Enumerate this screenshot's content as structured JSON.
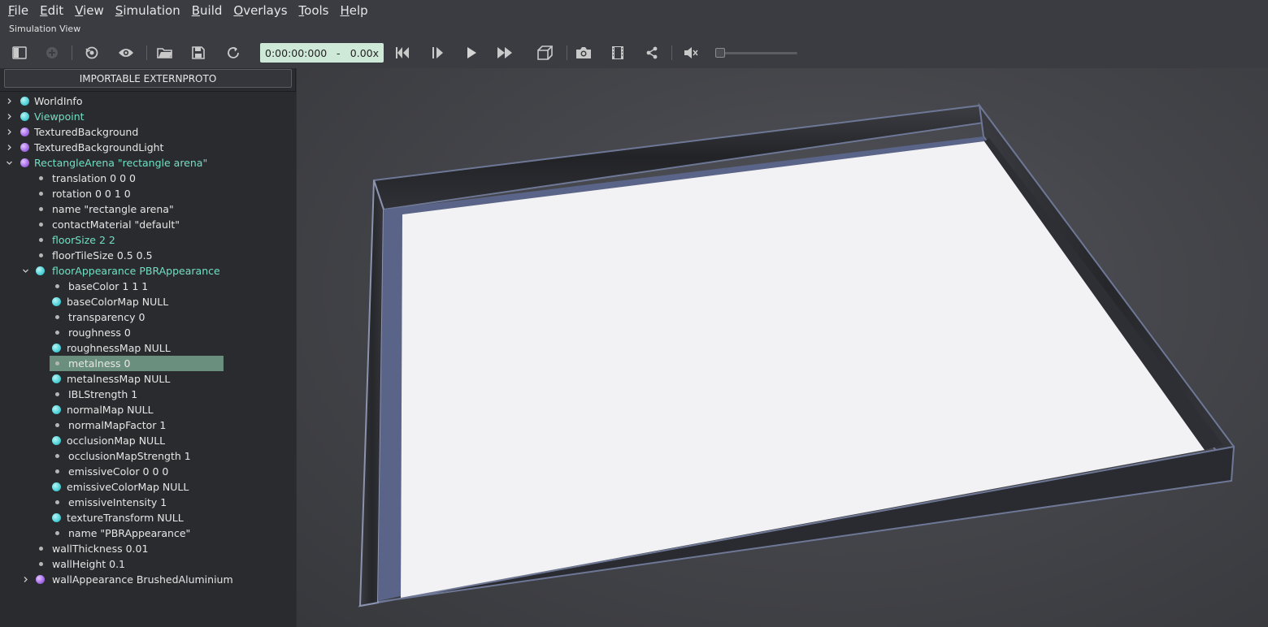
{
  "menu": [
    {
      "key": "F",
      "rest": "ile"
    },
    {
      "key": "E",
      "rest": "dit"
    },
    {
      "key": "V",
      "rest": "iew"
    },
    {
      "key": "S",
      "rest": "imulation"
    },
    {
      "key": "B",
      "rest": "uild"
    },
    {
      "key": "O",
      "rest": "verlays"
    },
    {
      "key": "T",
      "rest": "ools"
    },
    {
      "key": "H",
      "rest": "elp"
    }
  ],
  "view_label": "Simulation View",
  "toolbar": {
    "time": "0:00:00:000",
    "separator": "-",
    "speed": "0.00x",
    "icons": [
      "scene-tree-toggle-icon",
      "add-node-icon",
      "reset-view-icon",
      "eye-icon",
      "open-folder-icon",
      "save-icon",
      "reload-icon",
      "skip-back-icon",
      "step-icon",
      "play-icon",
      "fast-forward-icon",
      "perspective-cube-icon",
      "camera-icon",
      "movie-icon",
      "share-icon",
      "mute-icon"
    ],
    "volume": 0.0
  },
  "left_panel": {
    "proto_button": "IMPORTABLE EXTERNPROTO",
    "tree": [
      {
        "label": "WorldInfo",
        "chev": ">",
        "dot": "cyan",
        "level": 0,
        "hl": false
      },
      {
        "label": "Viewpoint",
        "chev": ">",
        "dot": "cyan",
        "level": 0,
        "hl": true
      },
      {
        "label": "TexturedBackground",
        "chev": ">",
        "dot": "purple",
        "level": 0,
        "hl": false
      },
      {
        "label": "TexturedBackgroundLight",
        "chev": ">",
        "dot": "purple",
        "level": 0,
        "hl": false
      },
      {
        "label": "RectangleArena \"rectangle arena\"",
        "chev": "v",
        "dot": "purple",
        "level": 0,
        "hl": true
      },
      {
        "label": "translation 0 0 0",
        "chev": "",
        "dot": "field",
        "level": 1,
        "hl": false
      },
      {
        "label": "rotation 0 0 1 0",
        "chev": "",
        "dot": "field",
        "level": 1,
        "hl": false
      },
      {
        "label": "name \"rectangle arena\"",
        "chev": "",
        "dot": "field",
        "level": 1,
        "hl": false
      },
      {
        "label": "contactMaterial \"default\"",
        "chev": "",
        "dot": "field",
        "level": 1,
        "hl": false
      },
      {
        "label": "floorSize 2 2",
        "chev": "",
        "dot": "field",
        "level": 1,
        "hl": true
      },
      {
        "label": "floorTileSize 0.5 0.5",
        "chev": "",
        "dot": "field",
        "level": 1,
        "hl": false
      },
      {
        "label": "floorAppearance PBRAppearance",
        "chev": "v",
        "dot": "cyan",
        "level": 1,
        "hl": true
      },
      {
        "label": "baseColor 1 1 1",
        "chev": "",
        "dot": "field",
        "level": 2,
        "hl": false
      },
      {
        "label": "baseColorMap NULL",
        "chev": "",
        "dot": "cyan",
        "level": 2,
        "hl": false
      },
      {
        "label": "transparency 0",
        "chev": "",
        "dot": "field",
        "level": 2,
        "hl": false
      },
      {
        "label": "roughness 0",
        "chev": "",
        "dot": "field",
        "level": 2,
        "hl": false
      },
      {
        "label": "roughnessMap NULL",
        "chev": "",
        "dot": "cyan",
        "level": 2,
        "hl": false
      },
      {
        "label": "metalness 0",
        "chev": "",
        "dot": "field",
        "level": 2,
        "hl": false,
        "selected": true
      },
      {
        "label": "metalnessMap NULL",
        "chev": "",
        "dot": "cyan",
        "level": 2,
        "hl": false
      },
      {
        "label": "IBLStrength 1",
        "chev": "",
        "dot": "field",
        "level": 2,
        "hl": false
      },
      {
        "label": "normalMap NULL",
        "chev": "",
        "dot": "cyan",
        "level": 2,
        "hl": false
      },
      {
        "label": "normalMapFactor 1",
        "chev": "",
        "dot": "field",
        "level": 2,
        "hl": false
      },
      {
        "label": "occlusionMap NULL",
        "chev": "",
        "dot": "cyan",
        "level": 2,
        "hl": false
      },
      {
        "label": "occlusionMapStrength 1",
        "chev": "",
        "dot": "field",
        "level": 2,
        "hl": false
      },
      {
        "label": "emissiveColor 0 0 0",
        "chev": "",
        "dot": "field",
        "level": 2,
        "hl": false
      },
      {
        "label": "emissiveColorMap NULL",
        "chev": "",
        "dot": "cyan",
        "level": 2,
        "hl": false
      },
      {
        "label": "emissiveIntensity 1",
        "chev": "",
        "dot": "field",
        "level": 2,
        "hl": false
      },
      {
        "label": "textureTransform NULL",
        "chev": "",
        "dot": "cyan",
        "level": 2,
        "hl": false
      },
      {
        "label": "name \"PBRAppearance\"",
        "chev": "",
        "dot": "field",
        "level": 2,
        "hl": false
      },
      {
        "label": "wallThickness 0.01",
        "chev": "",
        "dot": "field",
        "level": 1,
        "hl": false
      },
      {
        "label": "wallHeight 0.1",
        "chev": "",
        "dot": "field",
        "level": 1,
        "hl": false
      },
      {
        "label": "wallAppearance BrushedAluminium",
        "chev": ">",
        "dot": "purple",
        "level": 1,
        "hl": false
      }
    ]
  },
  "colors": {
    "highlight_text": "#6fe0c4",
    "selection": "#6b8f7e",
    "time_box": "#cfe9d8",
    "floor": "#f2f2f4",
    "wall_inner": "#5a6488",
    "wall_outer": "#2a2b30"
  }
}
